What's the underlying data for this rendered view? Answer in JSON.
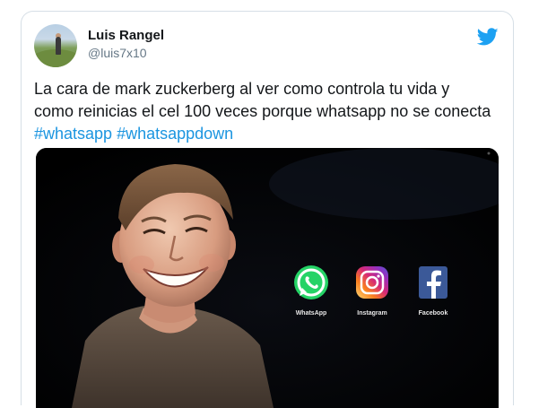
{
  "tweet": {
    "author_name": "Luis Rangel",
    "author_handle": "@luis7x10",
    "text_main": "La cara de mark zuckerberg al ver como controla tu vida y como reinicias el cel 100 veces porque whatsapp no se conecta ",
    "hashtags": [
      "#whatsapp",
      "#whatsappdown"
    ]
  },
  "media": {
    "logos": [
      {
        "label": "WhatsApp",
        "icon": "whatsapp-icon",
        "color": "#25d366"
      },
      {
        "label": "Instagram",
        "icon": "instagram-icon",
        "color": "#c13584"
      },
      {
        "label": "Facebook",
        "icon": "facebook-icon",
        "color": "#3b5998"
      }
    ]
  },
  "colors": {
    "twitter_blue": "#1da1f2",
    "hashtag": "#1b95e0",
    "handle_grey": "#657786"
  }
}
